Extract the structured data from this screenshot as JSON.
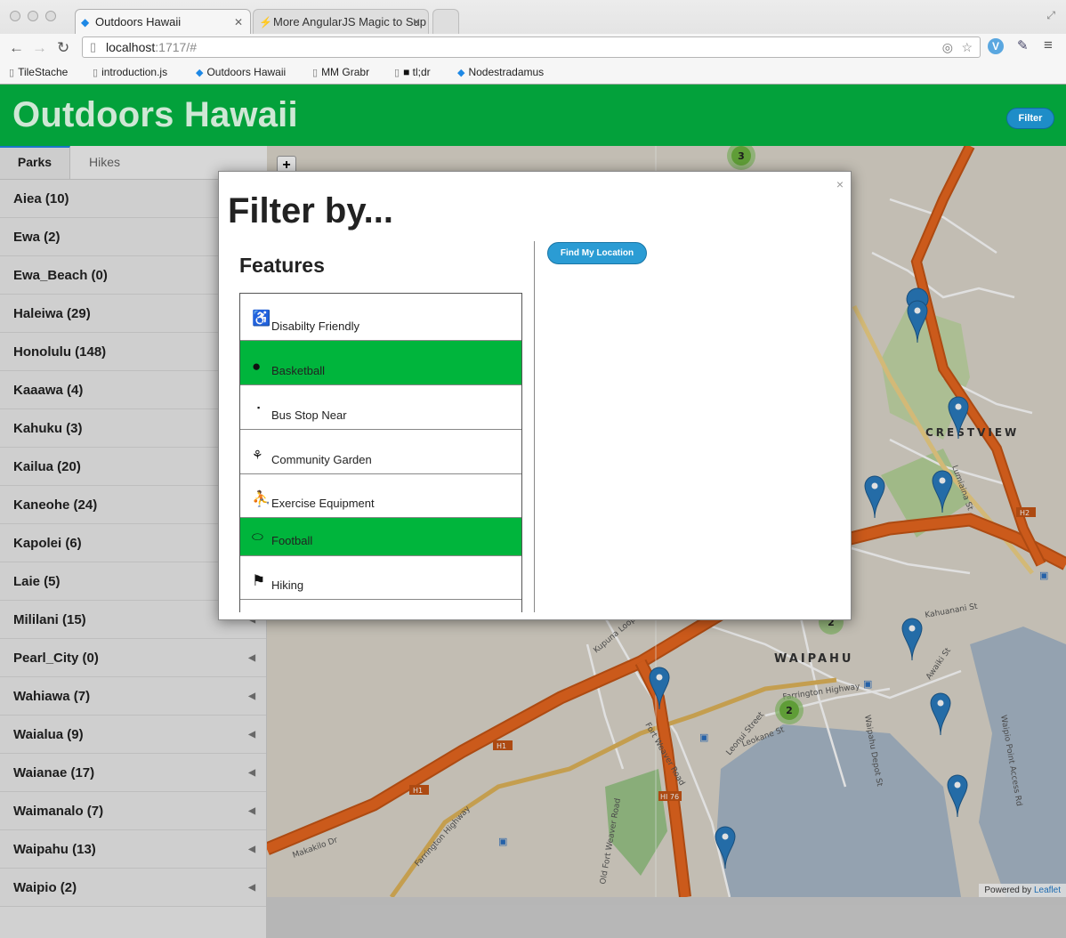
{
  "browser": {
    "tabs": [
      {
        "label": "Outdoors Hawaii",
        "icon": "angular-icon"
      },
      {
        "label": "More AngularJS Magic to Sup",
        "icon": "lightning-icon"
      }
    ],
    "url_host": "localhost",
    "url_path": ":1717/#",
    "bookmarks": [
      "TileStache",
      "introduction.js",
      "Outdoors Hawaii",
      "MM Grabr",
      "tl;dr",
      "Nodestradamus"
    ]
  },
  "app": {
    "title": "Outdoors Hawaii",
    "filter_label": "Filter"
  },
  "sidebar": {
    "tabs": [
      "Parks",
      "Hikes"
    ],
    "parks": [
      "Aiea (10)",
      "Ewa (2)",
      "Ewa_Beach (0)",
      "Haleiwa (29)",
      "Honolulu (148)",
      "Kaaawa (4)",
      "Kahuku (3)",
      "Kailua (20)",
      "Kaneohe (24)",
      "Kapolei (6)",
      "Laie (5)",
      "Mililani (15)",
      "Pearl_City (0)",
      "Wahiawa (7)",
      "Waialua (9)",
      "Waianae (17)",
      "Waimanalo (7)",
      "Waipahu (13)",
      "Waipio (2)"
    ]
  },
  "map": {
    "labels": {
      "crestview": "CRESTVIEW",
      "waipahu": "WAIPAHU",
      "farrington_hwy": "Farrington Highway",
      "farrington_hwy_sw": "Farrington Highway",
      "kupuna_loop": "Kupuna Loop",
      "old_fort_weaver": "Old Fort Weaver Road",
      "fort_weaver": "Fort Weaver Road",
      "makakilo": "Makakilo Dr",
      "waipio_point": "Waipio Point Access Rd",
      "leokane": "Leokane St",
      "leonui": "Leonui Street",
      "kahuanani": "Kahuanani St",
      "waipahu_depot": "Waipahu Depot St",
      "lumiaina": "Lumiaina St",
      "awaiki": "Awaiki St",
      "h1": "H1",
      "h2": "H2",
      "hi76": "HI 76"
    },
    "clusters": [
      "3",
      "2",
      "2"
    ],
    "attribution_prefix": "Powered by ",
    "attribution_link": "Leaflet",
    "zoom_in": "+"
  },
  "modal": {
    "close": "×",
    "title": "Filter by...",
    "features_title": "Features",
    "find_location_label": "Find My Location",
    "features": [
      {
        "label": "Disabilty Friendly",
        "icon": "wheelchair-icon",
        "selected": false
      },
      {
        "label": "Basketball",
        "icon": "basketball-icon",
        "selected": true
      },
      {
        "label": "Bus Stop Near",
        "icon": "bus-stop-icon",
        "selected": false
      },
      {
        "label": "Community Garden",
        "icon": "flower-icon",
        "selected": false
      },
      {
        "label": "Exercise Equipment",
        "icon": "exercise-icon",
        "selected": false
      },
      {
        "label": "Football",
        "icon": "football-icon",
        "selected": true
      },
      {
        "label": "Hiking",
        "icon": "hiking-icon",
        "selected": false
      }
    ]
  },
  "colors": {
    "header_green": "#03a13b",
    "selected_green": "#00b53c",
    "button_blue": "#2b9cd4",
    "highway_orange": "#e8671f",
    "pin_blue": "#2a7bbf"
  }
}
